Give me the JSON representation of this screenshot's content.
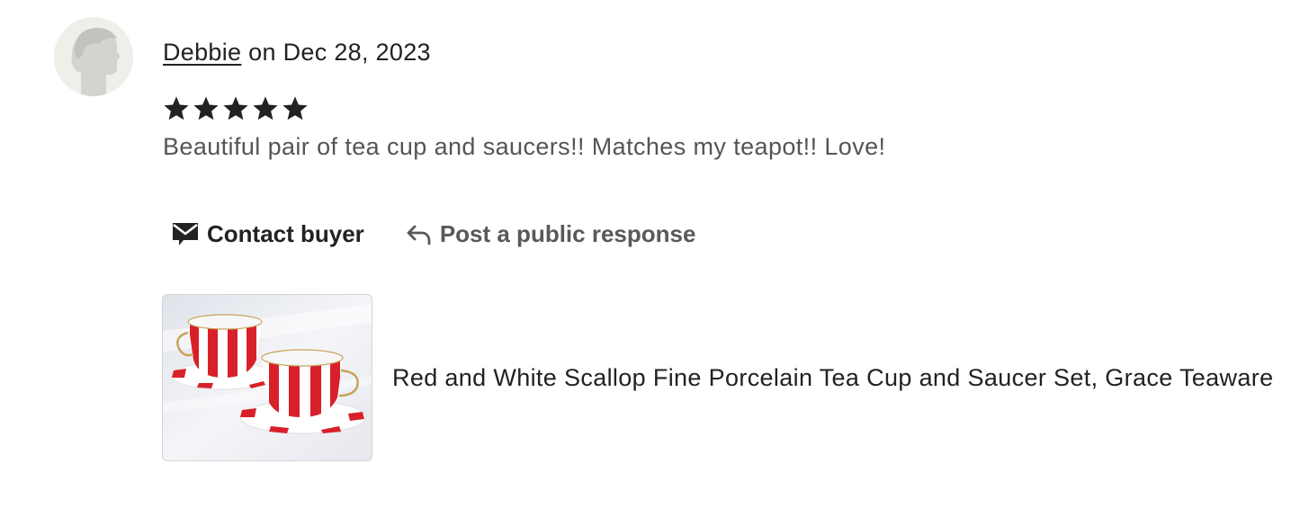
{
  "review": {
    "author": "Debbie",
    "date_text": " on Dec 28, 2023",
    "rating": 5,
    "max_rating": 5,
    "text": "Beautiful pair of tea cup and saucers!! Matches my teapot!! Love!"
  },
  "actions": {
    "contact_label": "Contact buyer",
    "contact_icon": "envelope-icon",
    "respond_label": "Post a public response",
    "respond_icon": "reply-arrow-icon"
  },
  "listing": {
    "title": "Red and White Scallop Fine Porcelain Tea Cup and Saucer Set, Grace Teaware"
  },
  "colors": {
    "text_primary": "#222222",
    "text_secondary": "#555555",
    "avatar_bg": "#efefea",
    "star": "#222222"
  }
}
